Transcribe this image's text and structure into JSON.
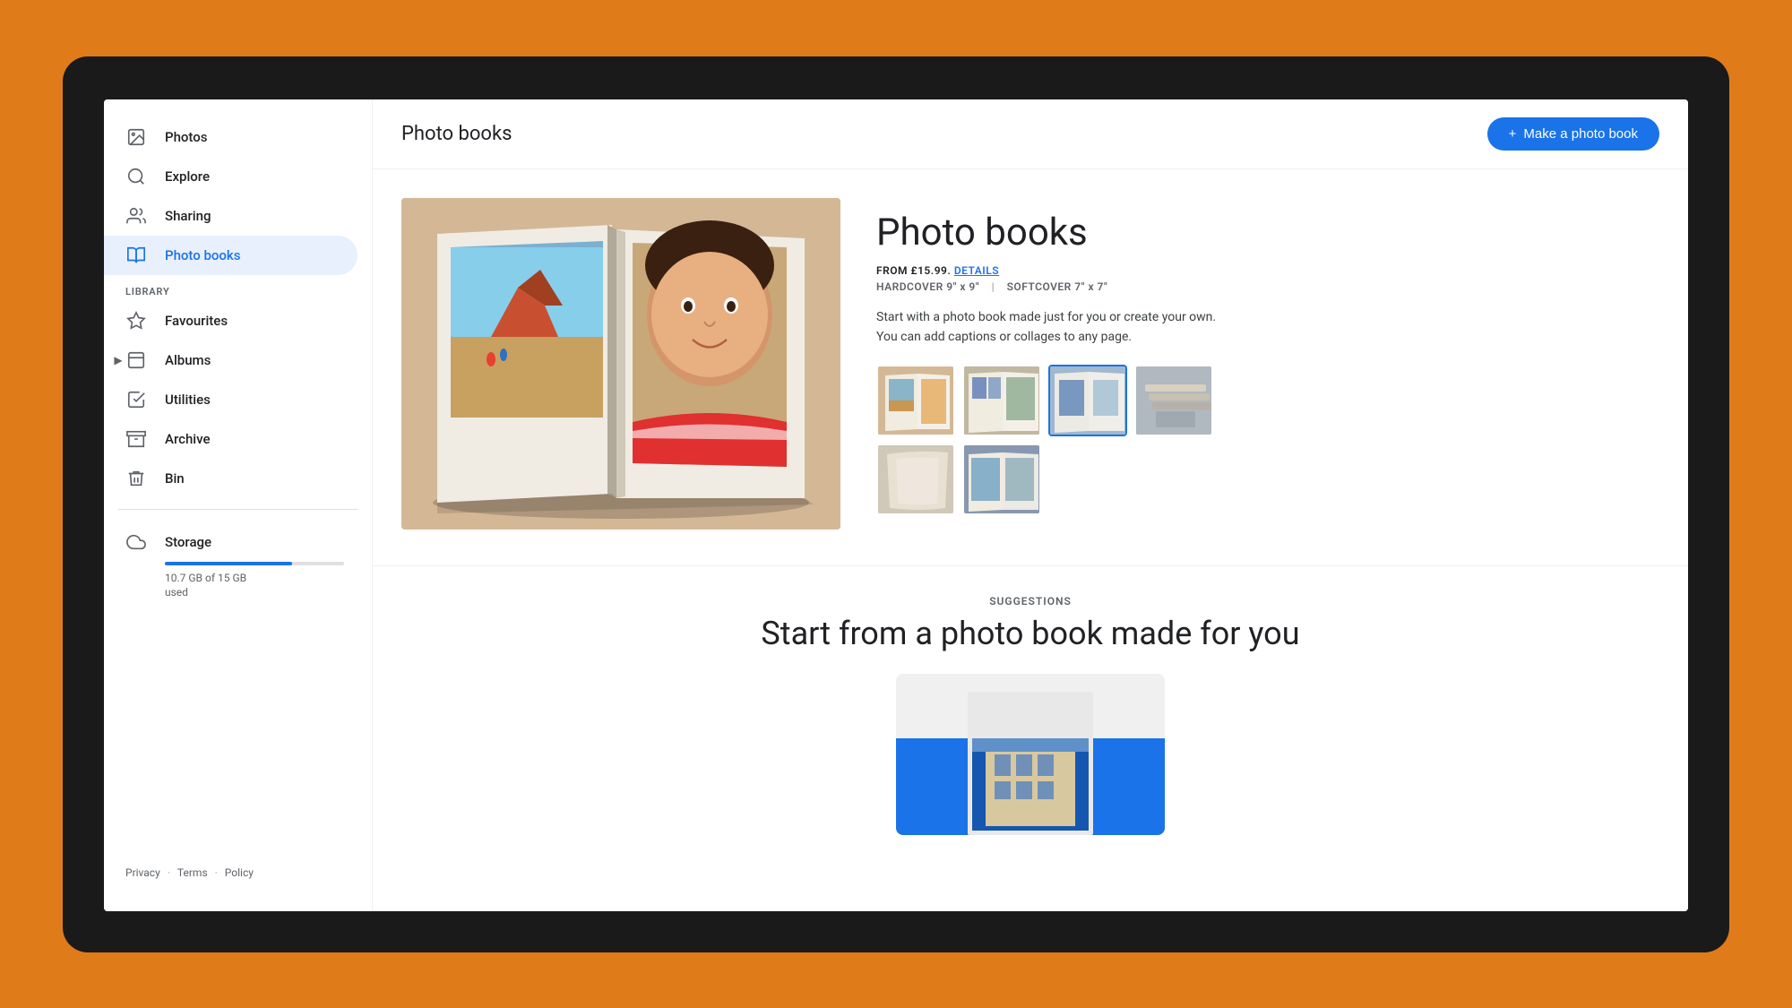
{
  "device": {
    "background_color": "#e07b1a"
  },
  "sidebar": {
    "nav_items": [
      {
        "id": "photos",
        "label": "Photos",
        "icon": "photo",
        "active": false
      },
      {
        "id": "explore",
        "label": "Explore",
        "icon": "explore",
        "active": false
      },
      {
        "id": "sharing",
        "label": "Sharing",
        "icon": "sharing",
        "active": false
      },
      {
        "id": "photo-books",
        "label": "Photo books",
        "icon": "book",
        "active": true
      }
    ],
    "library_label": "LIBRARY",
    "library_items": [
      {
        "id": "favourites",
        "label": "Favourites",
        "icon": "star",
        "has_arrow": false
      },
      {
        "id": "albums",
        "label": "Albums",
        "icon": "album",
        "has_arrow": true
      },
      {
        "id": "utilities",
        "label": "Utilities",
        "icon": "check",
        "has_arrow": false
      },
      {
        "id": "archive",
        "label": "Archive",
        "icon": "archive",
        "has_arrow": false
      },
      {
        "id": "bin",
        "label": "Bin",
        "icon": "bin",
        "has_arrow": false
      }
    ],
    "storage": {
      "label": "Storage",
      "used_gb": "10.7",
      "total_gb": "15",
      "used_text": "10.7 GB of 15 GB",
      "used_label": "used",
      "fill_percent": 71
    },
    "footer": {
      "privacy": "Privacy",
      "terms": "Terms",
      "policy": "Policy"
    }
  },
  "header": {
    "title": "Photo books",
    "make_book_button": "Make a photo book",
    "make_book_plus": "+"
  },
  "product": {
    "title": "Photo books",
    "price_label": "FROM £15.99.",
    "details_label": "DETAILS",
    "hardcover_label": "HARDCOVER 9\" x 9\"",
    "separator": "|",
    "softcover_label": "SOFTCOVER 7\" x 7\"",
    "description": "Start with a photo book made just for you or create your own.\nYou can add captions or collages to any page.",
    "thumbnails": [
      {
        "id": 1,
        "alt": "Photo book open flat"
      },
      {
        "id": 2,
        "alt": "Photo book collage view"
      },
      {
        "id": 3,
        "alt": "Photo book hardcover selected"
      },
      {
        "id": 4,
        "alt": "Photo book stacked"
      },
      {
        "id": 5,
        "alt": "Photo book pages fanned"
      },
      {
        "id": 6,
        "alt": "Photo book landscape open"
      }
    ]
  },
  "suggestions": {
    "label": "SUGGESTIONS",
    "title": "Start from a photo book made for you"
  }
}
